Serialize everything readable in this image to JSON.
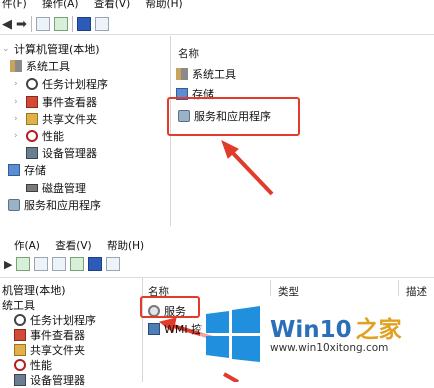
{
  "top": {
    "menu": [
      "件(F)",
      "操作(A)",
      "查看(V)",
      "帮助(H)"
    ],
    "tree": {
      "root": "计算机管理(本地)",
      "system_tools": "系统工具",
      "task_scheduler": "任务计划程序",
      "event_viewer": "事件查看器",
      "shared_folders": "共享文件夹",
      "performance": "性能",
      "device_manager": "设备管理器",
      "storage": "存储",
      "disk_management": "磁盘管理",
      "services_apps": "服务和应用程序"
    },
    "right": {
      "column_name": "名称",
      "items": [
        "系统工具",
        "存储",
        "服务和应用程序"
      ]
    }
  },
  "bottom": {
    "menu": [
      "作(A)",
      "查看(V)",
      "帮助(H)"
    ],
    "tree": {
      "root": "机管理(本地)",
      "system_tools": "统工具",
      "task_scheduler": "任务计划程序",
      "event_viewer": "事件查看器",
      "shared_folders": "共享文件夹",
      "performance": "性能",
      "device_manager": "设备管理器"
    },
    "right": {
      "column_name": "名称",
      "column_type": "类型",
      "column_desc": "描述",
      "items": [
        "服务",
        "WMI 控"
      ]
    }
  },
  "watermark": {
    "brand": "Win10",
    "brand_suffix": "之家",
    "url": "www.win10xitong.com"
  },
  "colors": {
    "highlight": "#e23a2b",
    "win_blue": "#1f8fde"
  }
}
